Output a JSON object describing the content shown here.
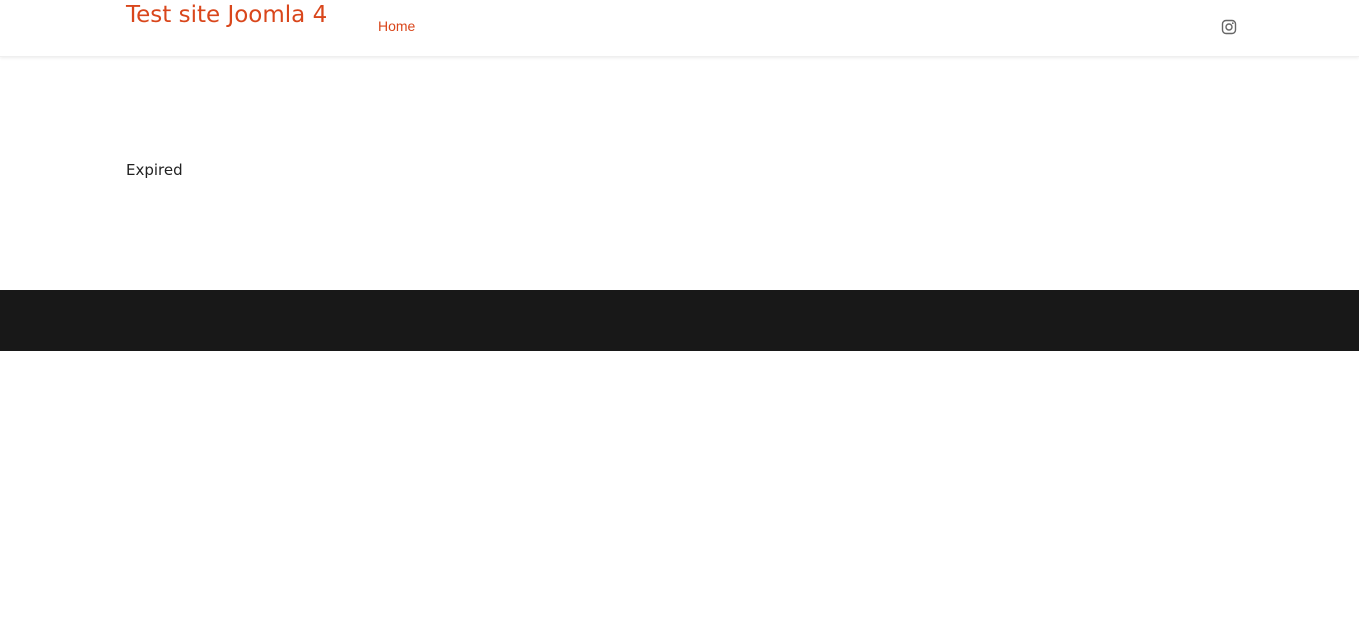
{
  "header": {
    "site_title": "Test site Joomla 4",
    "nav": [
      {
        "label": "Home",
        "active": true
      }
    ],
    "social": [
      {
        "icon": "instagram-icon"
      }
    ]
  },
  "main": {
    "message": "Expired"
  },
  "colors": {
    "accent": "#d9461b",
    "footer_bg": "#181818",
    "text": "#222222",
    "icon": "#666666"
  }
}
